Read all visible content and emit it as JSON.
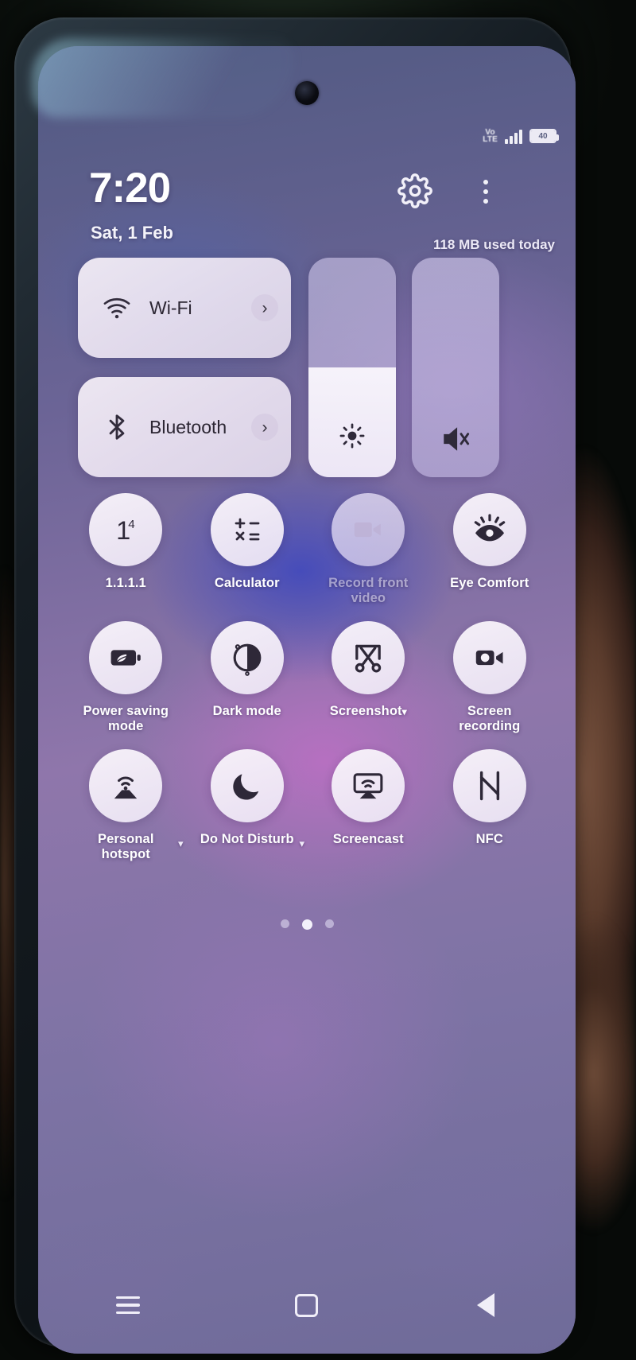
{
  "device": {
    "type": "android-phone",
    "panel": "quick-settings-shade"
  },
  "status_bar": {
    "volte_top": "Vo",
    "volte_bottom": "LTE",
    "signal_bars": 4,
    "battery_level": "40"
  },
  "header": {
    "time": "7:20",
    "date": "Sat, 1 Feb",
    "data_usage": "118 MB used today",
    "settings_icon": "gear-icon",
    "overflow_icon": "more-vertical-icon"
  },
  "connectivity_tiles": [
    {
      "label": "Wi-Fi",
      "icon": "wifi-icon",
      "chevron": "›",
      "state": "on"
    },
    {
      "label": "Bluetooth",
      "icon": "bluetooth-icon",
      "chevron": "›",
      "state": "on"
    }
  ],
  "sliders": {
    "brightness": {
      "icon": "brightness-sun-icon",
      "fill_percent": 50,
      "name": "Brightness"
    },
    "volume": {
      "icon": "volume-mute-icon",
      "fill_percent": 0,
      "name": "Volume",
      "state": "muted"
    }
  },
  "quick_toggles": [
    {
      "label": "1.1.1.1",
      "icon": "one-one-one-one-icon",
      "state": "on",
      "caret": ""
    },
    {
      "label": "Calculator",
      "icon": "calculator-icon",
      "state": "on",
      "caret": ""
    },
    {
      "label": "Record front video",
      "icon": "video-camera-icon",
      "state": "off",
      "caret": ""
    },
    {
      "label": "Eye Comfort",
      "icon": "eye-comfort-icon",
      "state": "on",
      "caret": ""
    },
    {
      "label": "Power saving mode",
      "icon": "battery-leaf-icon",
      "state": "on",
      "caret": ""
    },
    {
      "label": "Dark mode",
      "icon": "contrast-circle-icon",
      "state": "on",
      "caret": ""
    },
    {
      "label": "Screenshot",
      "icon": "scissors-screenshot-icon",
      "state": "on",
      "caret": "▾"
    },
    {
      "label": "Screen recording",
      "icon": "screen-record-icon",
      "state": "on",
      "caret": ""
    },
    {
      "label": "Personal hotspot",
      "icon": "hotspot-icon",
      "state": "on",
      "caret": "▾"
    },
    {
      "label": "Do Not Disturb",
      "icon": "moon-icon",
      "state": "on",
      "caret": "▾"
    },
    {
      "label": "Screencast",
      "icon": "screencast-icon",
      "state": "on",
      "caret": ""
    },
    {
      "label": "NFC",
      "icon": "nfc-icon",
      "state": "on",
      "caret": ""
    }
  ],
  "page_indicator": {
    "pages": 3,
    "active_index": 1
  },
  "nav_bar": [
    {
      "name": "recents-button",
      "icon": "hamburger-icon"
    },
    {
      "name": "home-button",
      "icon": "square-icon"
    },
    {
      "name": "back-button",
      "icon": "triangle-left-icon"
    }
  ],
  "colors": {
    "tile_surface": "#F3EDF7",
    "accent_text": "#FFFFFF",
    "icon_dark": "#3A3346",
    "wallpaper_purple": "#8F76AB",
    "wallpaper_blue": "#515A82"
  }
}
